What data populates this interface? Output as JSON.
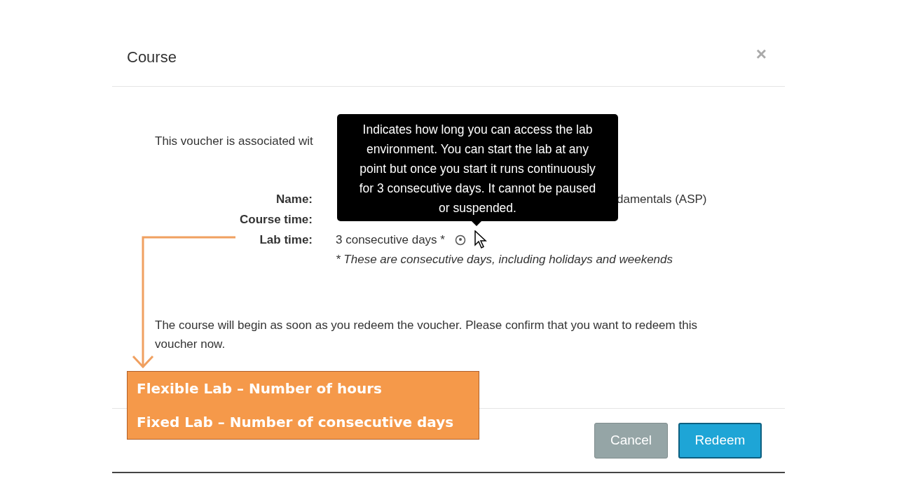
{
  "dialog": {
    "title": "Course",
    "close": "×",
    "intro": "This voucher is associated wit",
    "fields": [
      {
        "label": "Name:",
        "value": "damentals (ASP)"
      },
      {
        "label": "Course time:"
      },
      {
        "label": "Lab time:",
        "value": "3 consecutive days *"
      }
    ],
    "footnote": "* These are consecutive days, including holidays and weekends",
    "confirm": "The course will begin as soon as you redeem the voucher. Please confirm that you want to redeem this voucher now.",
    "buttons": [
      {
        "label": "Cancel",
        "kind": "secondary"
      },
      {
        "label": "Redeem",
        "kind": "primary"
      }
    ]
  },
  "tooltip": {
    "text": "Indicates how long you can access the lab environment. You can start the lab at any point but once you start it runs continuously for 3 consecutive days. It cannot be paused or suspended."
  },
  "callout": {
    "lines": [
      "Flexible Lab – Number of hours",
      "Fixed Lab –  Number of consecutive days"
    ]
  }
}
